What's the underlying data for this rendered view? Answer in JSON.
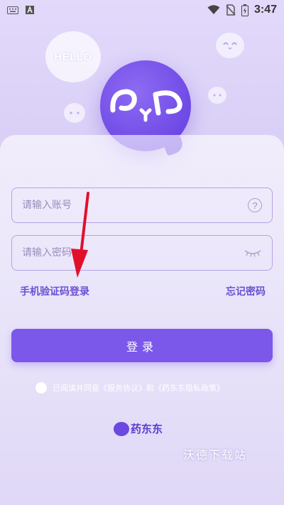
{
  "status_bar": {
    "time": "3:47",
    "icons": [
      "keyboard-icon",
      "a-icon",
      "wifi-icon",
      "no-sim-icon",
      "battery-icon"
    ]
  },
  "decor": {
    "hello_text": "HELLO",
    "mini_face": "ʘ̥ʘ"
  },
  "form": {
    "account_placeholder": "请输入账号",
    "password_placeholder": "请输入密码",
    "sms_login_label": "手机验证码登录",
    "forgot_password_label": "忘记密码",
    "login_button_label": "登录"
  },
  "agreement": {
    "prefix": "已阅读并同意",
    "service_link": "《服务协议》",
    "and": "和",
    "privacy_link": "《药东东隐私政策》"
  },
  "footer": {
    "brand": "药东东",
    "watermark": "沃德下载站"
  },
  "colors": {
    "accent": "#7b58ea",
    "link": "#6a4fd2",
    "arrow": "#e0102a"
  }
}
